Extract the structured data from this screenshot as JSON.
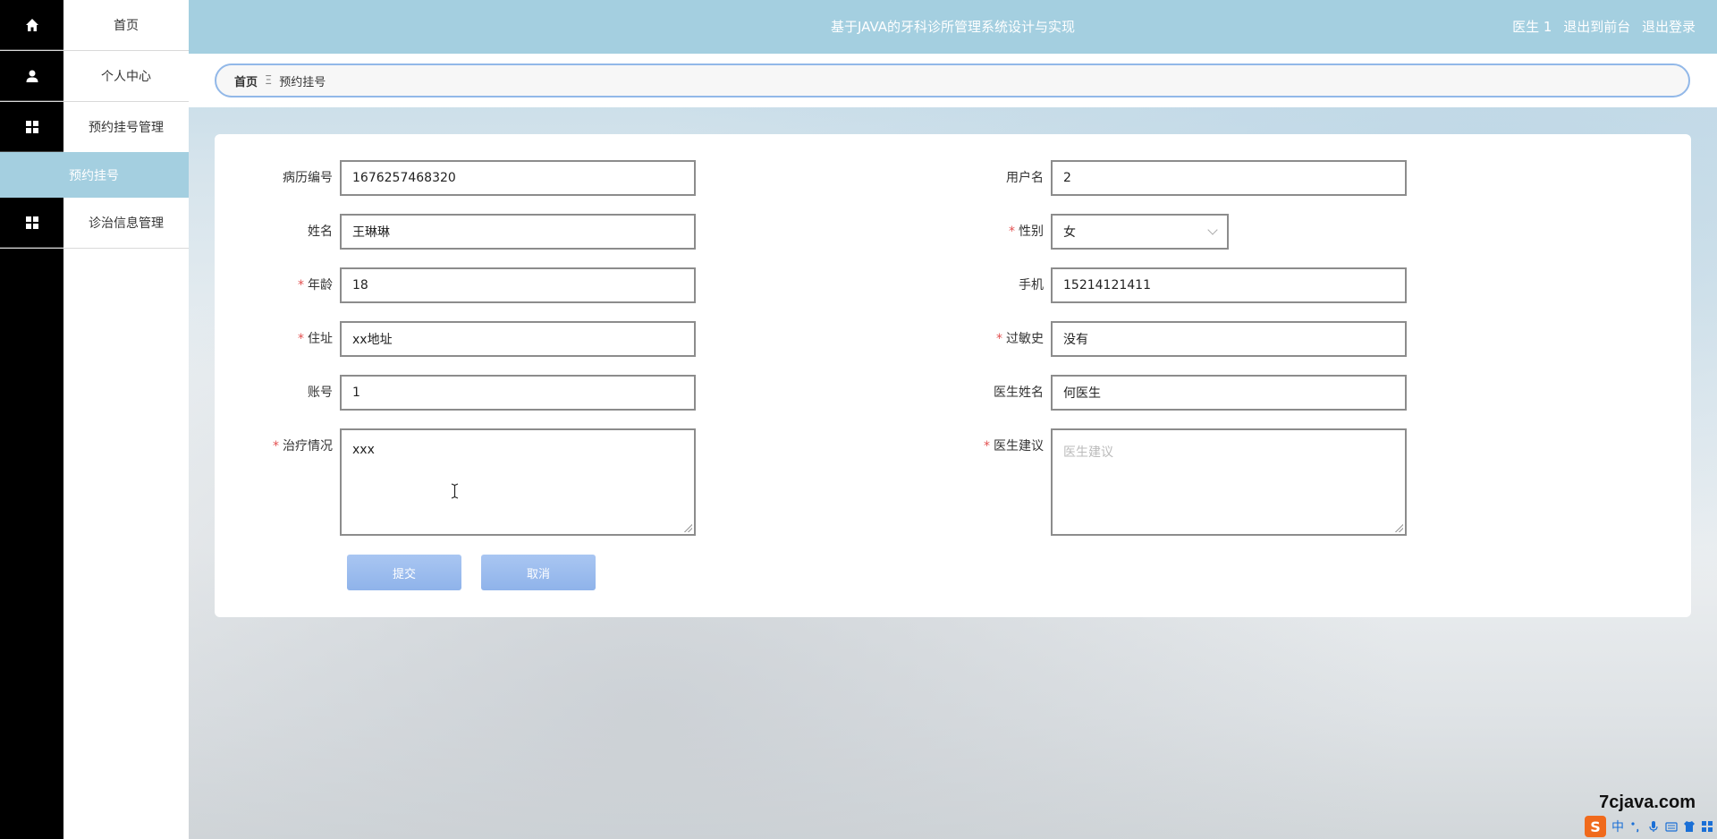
{
  "sidebar": {
    "items": [
      {
        "label": "首页",
        "icon": "home-icon"
      },
      {
        "label": "个人中心",
        "icon": "user-icon"
      },
      {
        "label": "预约挂号管理",
        "icon": "grid-icon"
      },
      {
        "label": "诊治信息管理",
        "icon": "grid-icon"
      }
    ],
    "active_sub": "预约挂号"
  },
  "header": {
    "title": "基于JAVA的牙科诊所管理系统设计与实现",
    "user": "医生 1",
    "back_to_front": "退出到前台",
    "logout": "退出登录"
  },
  "breadcrumb": {
    "home": "首页",
    "separator": "Ξ",
    "current": "预约挂号"
  },
  "form": {
    "record_no": {
      "label": "病历编号",
      "value": "1676257468320"
    },
    "username": {
      "label": "用户名",
      "value": "2"
    },
    "name": {
      "label": "姓名",
      "value": "王琳琳"
    },
    "gender": {
      "label": "性别",
      "value": "女"
    },
    "age": {
      "label": "年龄",
      "value": "18"
    },
    "phone": {
      "label": "手机",
      "value": "15214121411"
    },
    "address": {
      "label": "住址",
      "value": "xx地址"
    },
    "allergy": {
      "label": "过敏史",
      "value": "没有"
    },
    "account": {
      "label": "账号",
      "value": "1"
    },
    "doctor_name": {
      "label": "医生姓名",
      "value": "何医生"
    },
    "treatment": {
      "label": "治疗情况",
      "value": "xxx"
    },
    "advice": {
      "label": "医生建议",
      "placeholder": "医生建议"
    },
    "required_mark": "*",
    "submit": "提交",
    "cancel": "取消"
  },
  "watermark": "7cjava.com",
  "ime": {
    "logo": "S",
    "lang": "中"
  },
  "colors": {
    "header": "#a4cfe0",
    "sidebar_icons": "#000000",
    "button": "#8fb3ea",
    "required": "#e35151"
  }
}
